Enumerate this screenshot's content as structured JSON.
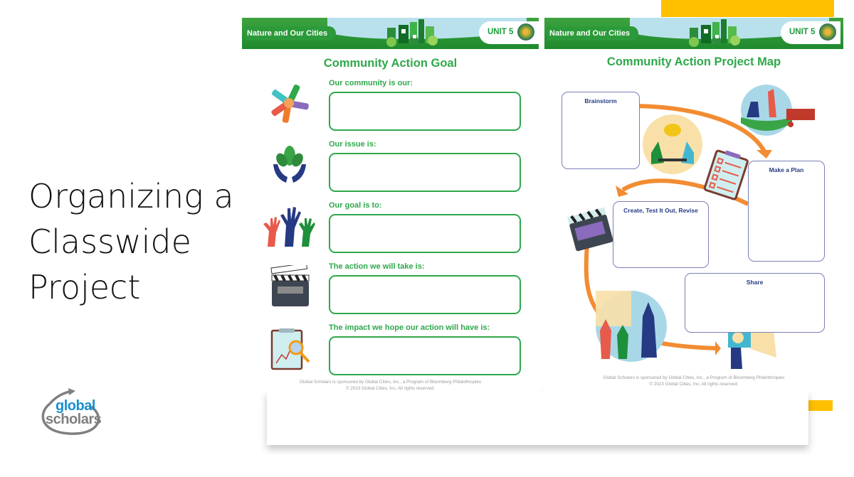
{
  "slide": {
    "title_lines": [
      "Organizing a",
      "Classwide",
      "Project"
    ],
    "accent_color": "#ffc000"
  },
  "logo": {
    "line1": "global",
    "line2": "scholars"
  },
  "pages": {
    "left": {
      "banner": {
        "series": "Nature and Our Cities",
        "unit": "UNIT 5"
      },
      "title": "Community Action Goal",
      "prompts": [
        {
          "label": "Our community is our:",
          "icon": "joined-hands-icon",
          "value": ""
        },
        {
          "label": "Our issue is:",
          "icon": "hands-holding-leaves-icon",
          "value": ""
        },
        {
          "label": "Our goal is to:",
          "icon": "raised-hands-icon",
          "value": ""
        },
        {
          "label": "The action we will take is:",
          "icon": "clapperboard-icon",
          "value": ""
        },
        {
          "label": "The impact we hope our action will have is:",
          "icon": "clipboard-magnifier-icon",
          "value": ""
        }
      ],
      "footer": {
        "line1": "Global Scholars is sponsored by Global Cities, Inc., a Program of Bloomberg Philanthropies",
        "line2": "© 2023 Global Cities, Inc. All rights reserved."
      }
    },
    "right": {
      "banner": {
        "series": "Nature and Our Cities",
        "unit": "UNIT 5"
      },
      "title": "Community Action Project Map",
      "boxes": [
        {
          "label": "Brainstorm"
        },
        {
          "label": "Make a Plan"
        },
        {
          "label": "Create, Test It Out, Revise"
        },
        {
          "label": "Share"
        }
      ],
      "footer": {
        "line1": "Global Scholars is sponsored by Global Cities, Inc., a Program of Bloomberg Philanthropies",
        "line2": "© 2023 Global Cities, Inc. All rights reserved."
      }
    }
  },
  "colors": {
    "green": "#2ea84b",
    "navy": "#253a83",
    "orange": "#f28c32"
  }
}
